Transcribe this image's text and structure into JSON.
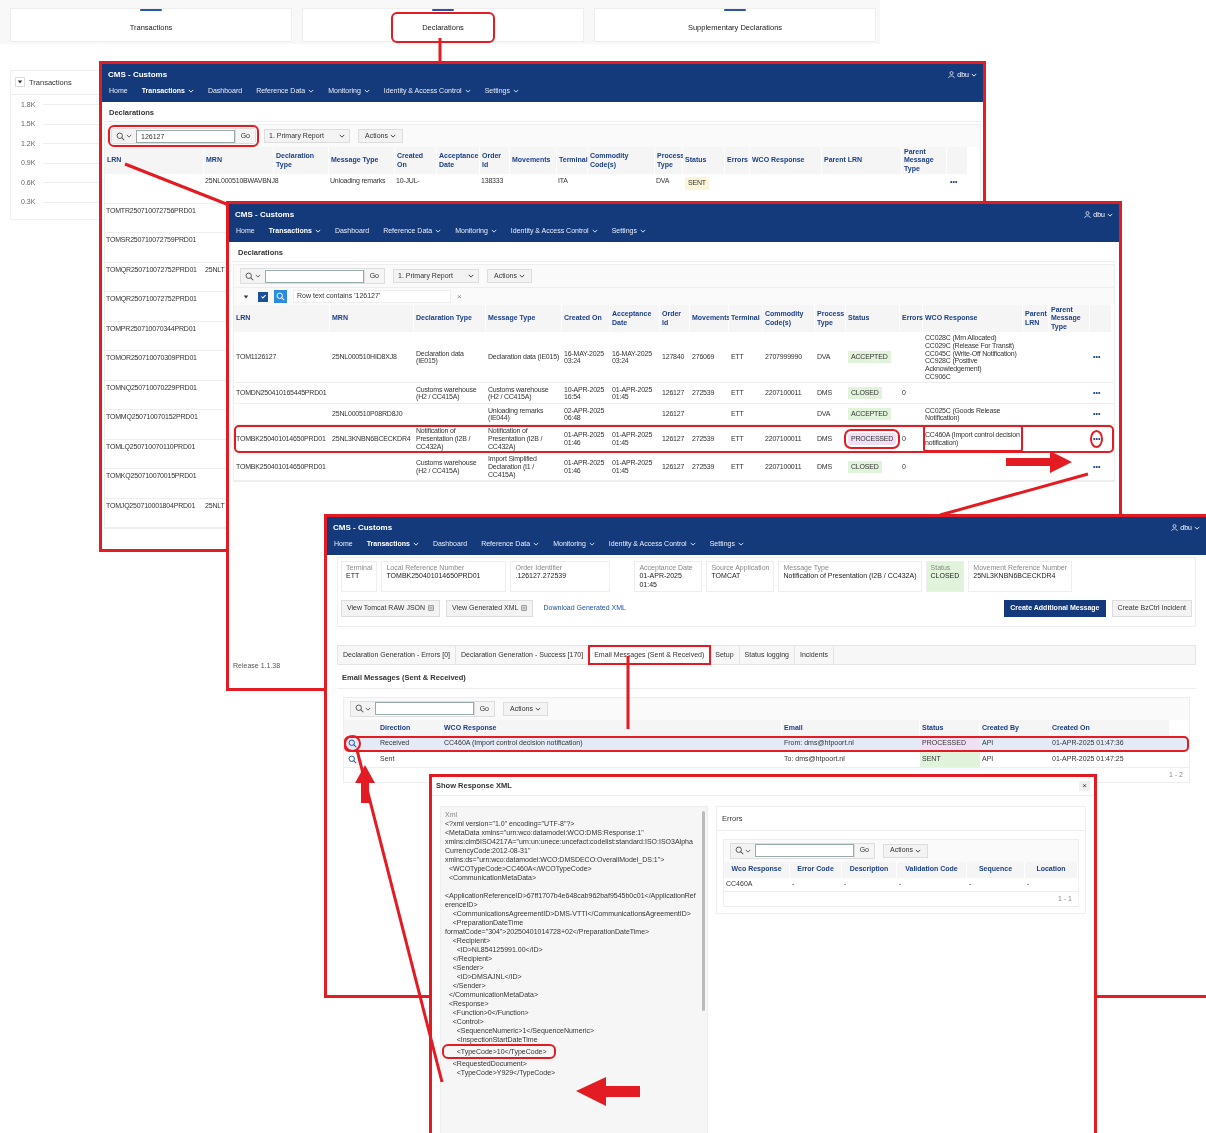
{
  "background": {
    "cards": [
      {
        "label": "Transactions",
        "highlighted": false
      },
      {
        "label": "Declarations",
        "highlighted": true
      },
      {
        "label": "Supplementary Declarations",
        "highlighted": false
      }
    ],
    "transactions_panel": {
      "title": "Transactions",
      "expanded": true,
      "y_ticks": [
        "1.8K",
        "1.5K",
        "1.2K",
        "0.9K",
        "0.6K",
        "0.3K"
      ]
    }
  },
  "declarations_window": {
    "header": {
      "title": "CMS - Customs",
      "user": "dbu",
      "nav": [
        {
          "label": "Home",
          "selected": false,
          "dropdown": false
        },
        {
          "label": "Transactions",
          "selected": true,
          "dropdown": true
        },
        {
          "label": "Dashboard",
          "selected": false,
          "dropdown": false
        },
        {
          "label": "Reference Data",
          "selected": false,
          "dropdown": true
        },
        {
          "label": "Monitoring",
          "selected": false,
          "dropdown": true
        },
        {
          "label": "Identity & Access Control",
          "selected": false,
          "dropdown": true
        },
        {
          "label": "Settings",
          "selected": false,
          "dropdown": true
        }
      ]
    },
    "region_title": "Declarations",
    "search": {
      "value": "126127",
      "highlighted": true
    },
    "go": "Go",
    "report": "1. Primary Report",
    "actions": "Actions",
    "columns": [
      "LRN",
      "MRN",
      "Declaration Type",
      "Message Type",
      "Created On",
      "Acceptance Date",
      "Order Id",
      "Movements",
      "Terminal",
      "Commodity Code(s)",
      "Process Type",
      "Status",
      "Errors",
      "WCO Response",
      "Parent LRN",
      "Parent Message Type"
    ],
    "rows": [
      {
        "cells": [
          "",
          "25NL000510BWAVBNJ8",
          "",
          "Unloading remarks",
          "10-JUL-",
          "",
          "138333",
          "",
          "ITA",
          "",
          "DVA",
          "",
          "",
          "",
          "",
          ""
        ],
        "status": {
          "label": "SENT",
          "color": "#fdf5d8"
        },
        "menu": "•••"
      },
      {
        "cells": [
          "TOMTR250710072756PRD01",
          ""
        ]
      },
      {
        "cells": [
          "TOMSR250710072759PRD01",
          ""
        ]
      },
      {
        "cells": [
          "TOMQR250710072752PRD01",
          "25NLT"
        ]
      },
      {
        "cells": [
          "TOMQR250710072752PRD01",
          ""
        ]
      },
      {
        "cells": [
          "TOMPR250710070344PRD01",
          ""
        ]
      },
      {
        "cells": [
          "TOMOR250710070309PRD01",
          ""
        ]
      },
      {
        "cells": [
          "TOMNQ250710070229PRD01",
          ""
        ]
      },
      {
        "cells": [
          "TOMMQ250710070152PRD01",
          ""
        ]
      },
      {
        "cells": [
          "TOMLQ250710070110PRD01",
          ""
        ]
      },
      {
        "cells": [
          "TOMKQ250710070015PRD01",
          ""
        ]
      },
      {
        "cells": [
          "TOMJQ250710001804PRD01",
          "25NLT"
        ]
      }
    ]
  },
  "filtered_window": {
    "header": {
      "title": "CMS - Customs",
      "user": "dbu",
      "nav": [
        {
          "label": "Home",
          "selected": false,
          "dropdown": false
        },
        {
          "label": "Transactions",
          "selected": true,
          "dropdown": true
        },
        {
          "label": "Dashboard",
          "selected": false,
          "dropdown": false
        },
        {
          "label": "Reference Data",
          "selected": false,
          "dropdown": true
        },
        {
          "label": "Monitoring",
          "selected": false,
          "dropdown": true
        },
        {
          "label": "Identity & Access Control",
          "selected": false,
          "dropdown": true
        },
        {
          "label": "Settings",
          "selected": false,
          "dropdown": true
        }
      ]
    },
    "region_title": "Declarations",
    "go": "Go",
    "report": "1. Primary Report",
    "actions": "Actions",
    "filter": {
      "expanded": true,
      "enabled": true,
      "text": "Row text contains '126127'",
      "remove": "×"
    },
    "columns": [
      "LRN",
      "MRN",
      "Declaration Type",
      "Message Type",
      "Created On",
      "Acceptance Date",
      "Order Id",
      "Movements",
      "Terminal",
      "Commodity Code(s)",
      "Process Type",
      "Status",
      "Errors",
      "WCO Response",
      "Parent LRN",
      "Parent Message Type"
    ],
    "rows": [
      {
        "highlighted": false,
        "cells": [
          "TOM1126127",
          "25NL000510HID8XJ8",
          "Declaration data (IE015)",
          "Declaration data (IE015)",
          "16-MAY-2025 03:24",
          "16-MAY-2025 03:24",
          "127840",
          "276069",
          "ETT",
          "2707999990",
          "DVA",
          "",
          "",
          "CC028C (Mrn Allocated)\nCC029C (Release For Transit)\nCC045C (Write-Off Notification)\nCC928C (Positive Acknowledgement)\nCC906C",
          "",
          ""
        ],
        "status": {
          "label": "ACCEPTED",
          "color": "#e2f3dc",
          "highlighted": false
        },
        "wco_highlighted": false,
        "menu": "•••",
        "menu_highlighted": false
      },
      {
        "highlighted": false,
        "cells": [
          "TOMDN250410165445PRD01",
          "",
          "Customs warehouse (H2 / CC415A)",
          "Customs warehouse (H2 / CC415A)",
          "10-APR-2025 16:54",
          "01-APR-2025 01:45",
          "126127",
          "272539",
          "ETT",
          "2207100011",
          "DMS",
          "",
          "0",
          "",
          "",
          ""
        ],
        "status": {
          "label": "CLOSED",
          "color": "#e2f3dc",
          "highlighted": false
        },
        "wco_highlighted": false,
        "menu": "•••",
        "menu_highlighted": false
      },
      {
        "highlighted": false,
        "cells": [
          "",
          "25NL000510P08RD8J0",
          "",
          "Unloading remarks (IE044)",
          "02-APR-2025 06:48",
          "",
          "126127",
          "",
          "ETT",
          "",
          "DVA",
          "",
          "",
          "CC025C (Goods Release Notification)",
          "",
          ""
        ],
        "status": {
          "label": "ACCEPTED",
          "color": "#e2f3dc",
          "highlighted": false
        },
        "wco_highlighted": false,
        "menu": "•••",
        "menu_highlighted": false
      },
      {
        "highlighted": true,
        "cells": [
          "TOMBK250401014650PRD01",
          "25NL3KNBN6BCECKDR4",
          "Notification of Presentation (I2B / CC432A)",
          "Notification of Presentation (I2B / CC432A)",
          "01-APR-2025 01:46",
          "01-APR-2025 01:45",
          "126127",
          "272539",
          "ETT",
          "2207100011",
          "DMS",
          "",
          "0",
          "CC460A (Import control decision notification)",
          "",
          ""
        ],
        "status": {
          "label": "PROCESSED",
          "color": "#f1e0f5",
          "highlighted": true
        },
        "wco_highlighted": true,
        "menu": "•••",
        "menu_highlighted": true
      },
      {
        "highlighted": false,
        "cells": [
          "TOMBK250401014650PRD01",
          "",
          "Customs warehouse (H2 / CC415A)",
          "Import Simplified Declaration (I1 / CC415A)",
          "01-APR-2025 01:46",
          "01-APR-2025 01:45",
          "126127",
          "272539",
          "ETT",
          "2207100011",
          "DMS",
          "",
          "0",
          "",
          "",
          ""
        ],
        "status": {
          "label": "CLOSED",
          "color": "#e2f3dc",
          "highlighted": false
        },
        "wco_highlighted": false,
        "menu": "•••",
        "menu_highlighted": false
      }
    ],
    "release": "Release 1.1.38"
  },
  "detail_window": {
    "header": {
      "title": "CMS - Customs",
      "user": "dbu",
      "nav": [
        {
          "label": "Home",
          "selected": false,
          "dropdown": false
        },
        {
          "label": "Transactions",
          "selected": true,
          "dropdown": true
        },
        {
          "label": "Dashboard",
          "selected": false,
          "dropdown": false
        },
        {
          "label": "Reference Data",
          "selected": false,
          "dropdown": true
        },
        {
          "label": "Monitoring",
          "selected": false,
          "dropdown": true
        },
        {
          "label": "Identity & Access Control",
          "selected": false,
          "dropdown": true
        },
        {
          "label": "Settings",
          "selected": false,
          "dropdown": true
        }
      ]
    },
    "fields": [
      {
        "label": "Terminal",
        "value": "ETT",
        "color": "#ffffff"
      },
      {
        "label": "Local Reference Number",
        "value": "TOMBK250401014650PRD01",
        "color": "#ffffff"
      },
      {
        "label": "Order Identifier",
        "value": ".126127.272539",
        "color": "#ffffff"
      },
      {
        "label": "Acceptance Date",
        "value": "01-APR-2025 01:45",
        "color": "#ffffff"
      },
      {
        "label": "Source Application",
        "value": "TOMCAT",
        "color": "#ffffff"
      },
      {
        "label": "Message Type",
        "value": "Notification of Presentation (I2B / CC432A)",
        "color": "#ffffff"
      },
      {
        "label": "Status",
        "value": "CLOSED",
        "color": "#e2f3dc"
      },
      {
        "label": "Movement Reference Number",
        "value": "25NL3KNBN6BCECKDR4",
        "color": "#ffffff"
      }
    ],
    "buttons": [
      {
        "label": "View Tomcat RAW JSON",
        "kind": "secondary"
      },
      {
        "label": "View Generated XML",
        "kind": "secondary"
      },
      {
        "label": "Download Generated XML",
        "kind": "link"
      }
    ],
    "right_buttons": [
      {
        "label": "Create Additional Message",
        "kind": "primary"
      },
      {
        "label": "Create BzCtrl Incident",
        "kind": "secondary"
      }
    ],
    "tabs": [
      {
        "label": "Declaration Generation - Errors [0]",
        "selected": false
      },
      {
        "label": "Declaration Generation - Success [170]",
        "selected": false
      },
      {
        "label": "Email Messages (Sent & Received)",
        "selected": true
      },
      {
        "label": "Setup",
        "selected": false
      },
      {
        "label": "Status logging",
        "selected": false
      },
      {
        "label": "Incidents",
        "selected": false
      }
    ],
    "region_title": "Email Messages (Sent & Received)",
    "go": "Go",
    "actions": "Actions",
    "columns": [
      "Direction",
      "WCO Response",
      "Email",
      "Status",
      "Created By",
      "Created On"
    ],
    "rows": [
      {
        "selected": true,
        "cells": [
          "Received",
          "CC460A (Import control decision notification)",
          "From: dms@htpoort.nl",
          "",
          "API",
          "01-APR-2025 01:47:36"
        ],
        "status": {
          "label": "PROCESSED",
          "color": "#f1e0f5"
        }
      },
      {
        "selected": false,
        "cells": [
          "Sent",
          "",
          "To: dms@htpoort.nl",
          "",
          "API",
          "01-APR-2025 01:47:25"
        ],
        "status": {
          "label": "SENT",
          "color": "#e2f3dc"
        }
      }
    ],
    "pagination": "1 - 2"
  },
  "xml_dialog": {
    "title": "Show Response XML",
    "close": "×",
    "xml_label": "Xml",
    "lines": [
      {
        "text": "<?xml version=\"1.0\" encoding=\"UTF-8\"?>",
        "highlighted": false
      },
      {
        "text": "<MetaData xmlns=\"urn:wco:datamodel:WCO:DMS:Response:1\"",
        "highlighted": false
      },
      {
        "text": "xmlns:clm5ISO4217A=\"urn:un:unece:uncefact:codelist:standard:ISO:ISO3AlphaCurrencyCode:2012-08-31\"",
        "highlighted": false
      },
      {
        "text": "xmlns:ds=\"urn:wco:datamodel:WCO:DMSDECO:OverallModel_DS:1\">",
        "highlighted": false
      },
      {
        "text": "  <WCOTypeCode>CC460A</WCOTypeCode>",
        "highlighted": false
      },
      {
        "text": "  <CommunicationMetaData>",
        "highlighted": false
      },
      {
        "text": "<ApplicationReferenceID>67ff1707b4e648cab962baf9545b0c01</ApplicationReferenceID>",
        "highlighted": false
      },
      {
        "text": "    <CommunicationsAgreementID>DMS-VTTI</CommunicationsAgreementID>",
        "highlighted": false
      },
      {
        "text": "    <PreparationDateTime",
        "highlighted": false
      },
      {
        "text": "formatCode=\"304\">20250401014728+02</PreparationDateTime>",
        "highlighted": false
      },
      {
        "text": "    <Recipient>",
        "highlighted": false
      },
      {
        "text": "      <ID>NL854125991.00</ID>",
        "highlighted": false
      },
      {
        "text": "    </Recipient>",
        "highlighted": false
      },
      {
        "text": "    <Sender>",
        "highlighted": false
      },
      {
        "text": "      <ID>DMSAJNL</ID>",
        "highlighted": false
      },
      {
        "text": "    </Sender>",
        "highlighted": false
      },
      {
        "text": "  </CommunicationMetaData>",
        "highlighted": false
      },
      {
        "text": "  <Response>",
        "highlighted": false
      },
      {
        "text": "    <Function>0</Function>",
        "highlighted": false
      },
      {
        "text": "    <Control>",
        "highlighted": false
      },
      {
        "text": "      <SequenceNumeric>1</SequenceNumeric>",
        "highlighted": false
      },
      {
        "text": "      <InspectionStartDateTime",
        "highlighted": false
      },
      {
        "text": "      <TypeCode>10</TypeCode>",
        "highlighted": true
      },
      {
        "text": "    <RequestedDocument>",
        "highlighted": false
      },
      {
        "text": "      <TypeCode>Y929</TypeCode>",
        "highlighted": false
      }
    ],
    "errors": {
      "title": "Errors",
      "go": "Go",
      "actions": "Actions",
      "columns": [
        "Wco Response",
        "Error Code",
        "Description",
        "Validation Code",
        "Sequence",
        "Location"
      ],
      "rows": [
        [
          "CC460A",
          "-",
          "-",
          "-",
          "-",
          "-"
        ]
      ],
      "pagination": "1 - 1"
    }
  }
}
